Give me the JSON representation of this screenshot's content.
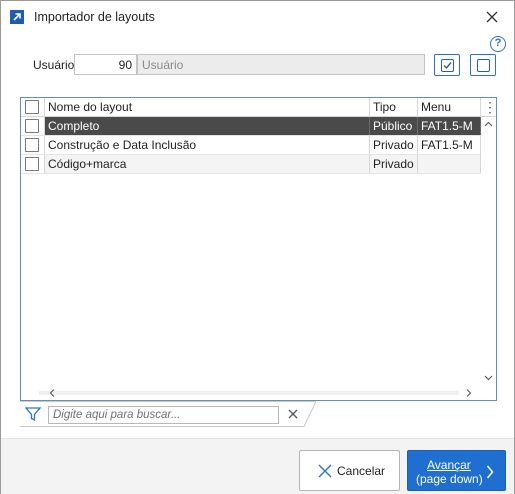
{
  "window": {
    "title": "Importador de layouts",
    "icons": {
      "app": "arrow-up-right-icon",
      "close": "close-icon",
      "help": "help-icon"
    },
    "help_glyph": "?"
  },
  "user": {
    "label": "Usuário",
    "code": "90",
    "name_placeholder": "Usuário"
  },
  "toolbar": {
    "check_all_icon": "checkbox-checked-icon",
    "uncheck_all_icon": "checkbox-empty-icon"
  },
  "grid": {
    "columns": [
      "Nome do layout",
      "Tipo",
      "Menu"
    ],
    "rows": [
      {
        "name": "Completo",
        "tipo": "Público",
        "menu": "FAT1.5-M",
        "selected": true
      },
      {
        "name": "Construção e Data Inclusão",
        "tipo": "Privado",
        "menu": "FAT1.5-M",
        "selected": false
      },
      {
        "name": "Código+marca",
        "tipo": "Privado",
        "menu": "",
        "selected": false
      }
    ],
    "more_glyph": "⋮"
  },
  "filter": {
    "placeholder": "Digite aqui para buscar...",
    "icons": {
      "filter": "filter-icon",
      "clear": "clear-icon"
    }
  },
  "footer": {
    "cancel_label": "Cancelar",
    "next_label_line1": "Avançar",
    "next_label_line2": "(page down)"
  },
  "colors": {
    "accent": "#1f6fd1",
    "selected_row": "#4a4a4a",
    "grid_border": "#5f8fc4"
  }
}
